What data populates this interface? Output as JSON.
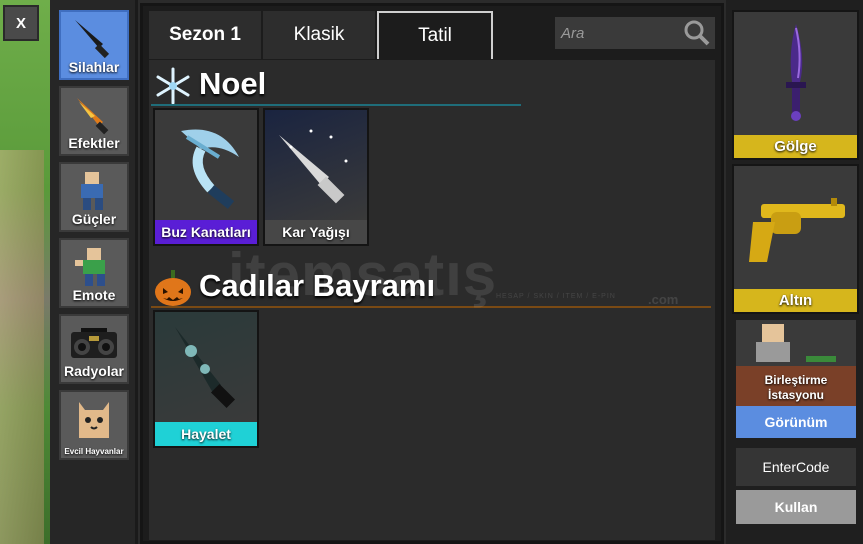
{
  "close": {
    "label": "X"
  },
  "sidebar": {
    "items": [
      {
        "label": "Silahlar",
        "icon": "knife-icon",
        "active": true
      },
      {
        "label": "Efektler",
        "icon": "fire-knife-icon"
      },
      {
        "label": "Güçler",
        "icon": "running-avatar-icon"
      },
      {
        "label": "Emote",
        "icon": "dancing-avatar-icon"
      },
      {
        "label": "Radyolar",
        "icon": "boombox-icon"
      },
      {
        "label": "Evcil Hayvanlar",
        "icon": "pet-cat-icon"
      }
    ]
  },
  "tabs": [
    {
      "label": "Sezon 1"
    },
    {
      "label": "Klasik"
    },
    {
      "label": "Tatil",
      "active": true
    }
  ],
  "search": {
    "placeholder": "Ara"
  },
  "sections": [
    {
      "title": "Noel",
      "icon": "snowflake-icon",
      "line_color": "#1f6d7a",
      "items": [
        {
          "name": "Buz Kanatları",
          "label_color": "#5a1ed6"
        },
        {
          "name": "Kar Yağışı",
          "label_color": "#474747"
        }
      ]
    },
    {
      "title": "Cadılar Bayramı",
      "icon": "pumpkin-icon",
      "line_color": "#7a4a14",
      "items": [
        {
          "name": "Hayalet",
          "label_color": "#1fd1d6"
        }
      ]
    }
  ],
  "watermark": {
    "text": "itemsatış",
    "sub": "HESAP / SKIN / ITEM / E-PIN",
    "domain": ".com"
  },
  "equipped": [
    {
      "name": "Gölge",
      "icon": "shadow-knife-icon"
    },
    {
      "name": "Altın",
      "icon": "gold-revolver-icon"
    }
  ],
  "crafting": {
    "label": "Birleştirme İstasyonu",
    "button": "Görünüm"
  },
  "code": {
    "placeholder": "EnterCode",
    "button": "Kullan"
  },
  "colors": {
    "accent_blue": "#5b8de0",
    "gold": "#d6b61c"
  }
}
